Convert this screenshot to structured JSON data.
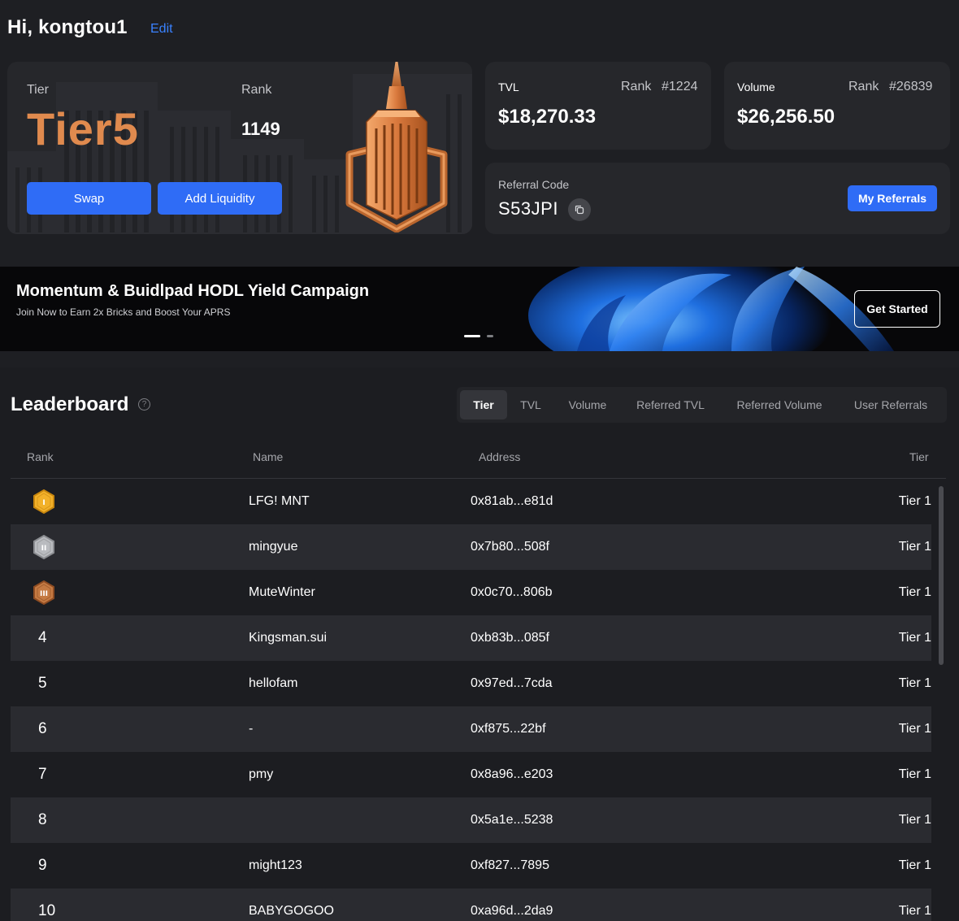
{
  "header": {
    "greeting": "Hi, kongtou1",
    "edit_label": "Edit"
  },
  "tier_card": {
    "tier_label": "Tier",
    "tier_value": "Tier5",
    "rank_label": "Rank",
    "rank_value": "1149",
    "swap_label": "Swap",
    "add_liquidity_label": "Add Liquidity",
    "tower_icon": "tier-tower-icon"
  },
  "tvl_card": {
    "title": "TVL",
    "rank_label": "Rank",
    "rank_value": "#1224",
    "amount": "$18,270.33"
  },
  "volume_card": {
    "title": "Volume",
    "rank_label": "Rank",
    "rank_value": "#26839",
    "amount": "$26,256.50"
  },
  "referral": {
    "label": "Referral Code",
    "code": "S53JPI",
    "copy_icon": "copy-icon",
    "my_referrals_label": "My Referrals"
  },
  "banner": {
    "title": "Momentum & Buidlpad HODL Yield Campaign",
    "subtitle": "Join Now to Earn 2x Bricks and Boost Your APRS",
    "cta_label": "Get Started",
    "active_slide": 1,
    "slide_count": 2
  },
  "leaderboard": {
    "title": "Leaderboard",
    "help_icon": "help-circle-icon",
    "tabs": [
      "Tier",
      "TVL",
      "Volume",
      "Referred TVL",
      "Referred Volume",
      "User Referrals"
    ],
    "active_tab": "Tier",
    "columns": [
      "Rank",
      "Name",
      "Address",
      "Tier"
    ],
    "rows": [
      {
        "rank": "1",
        "medal": "gold-medal-icon",
        "name": "LFG! MNT",
        "address": "0x81ab...e81d",
        "tier": "Tier 1"
      },
      {
        "rank": "2",
        "medal": "silver-medal-icon",
        "name": "mingyue",
        "address": "0x7b80...508f",
        "tier": "Tier 1"
      },
      {
        "rank": "3",
        "medal": "bronze-medal-icon",
        "name": "MuteWinter",
        "address": "0x0c70...806b",
        "tier": "Tier 1"
      },
      {
        "rank": "4",
        "name": "Kingsman.sui",
        "address": "0xb83b...085f",
        "tier": "Tier 1"
      },
      {
        "rank": "5",
        "name": "hellofam",
        "address": "0x97ed...7cda",
        "tier": "Tier 1"
      },
      {
        "rank": "6",
        "name": "-",
        "address": "0xf875...22bf",
        "tier": "Tier 1"
      },
      {
        "rank": "7",
        "name": "pmy",
        "address": "0x8a96...e203",
        "tier": "Tier 1"
      },
      {
        "rank": "8",
        "name": "",
        "address": "0x5a1e...5238",
        "tier": "Tier 1"
      },
      {
        "rank": "9",
        "name": "might123",
        "address": "0xf827...7895",
        "tier": "Tier 1"
      },
      {
        "rank": "10",
        "name": "BABYGOGOO",
        "address": "0xa96d...2da9",
        "tier": "Tier 1"
      }
    ]
  },
  "colors": {
    "background": "#1e1f23",
    "card": "#26272b",
    "accent_blue": "#2f6cf6",
    "tier_orange": "#e08a4e",
    "link_blue": "#3a82ff"
  }
}
